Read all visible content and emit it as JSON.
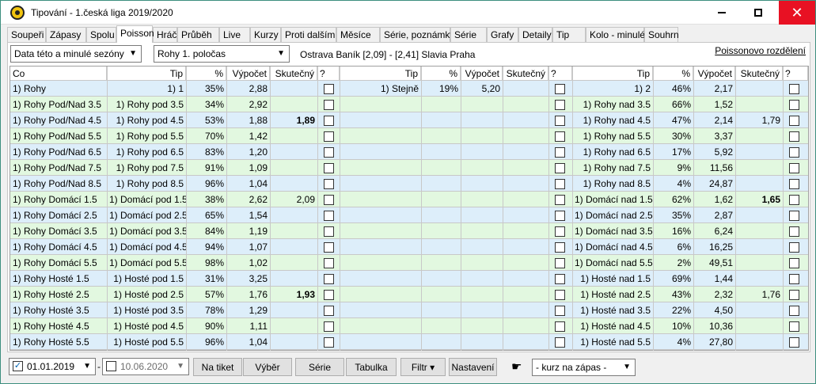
{
  "window": {
    "title": "Tipování - 1.česká liga 2019/2020"
  },
  "tabs": [
    "Soupeři",
    "Zápasy",
    "Spolu",
    "Poisson",
    "Hráči",
    "Průběh",
    "Live",
    "Kurzy",
    "Proti dalším",
    "Měsíce",
    "Série, poznámky",
    "Série",
    "Grafy",
    "Detaily",
    "Tip",
    "Kolo - minulé",
    "Souhrn"
  ],
  "active_tab": "Poisson",
  "filters": {
    "seasons": "Data této a minulé sezóny",
    "market": "Rohy 1. poločas",
    "match": "Ostrava Baník [2,09] - [2,41] Slavia Praha",
    "poisson_link": "Poissonovo rozdělení"
  },
  "columns": {
    "co": "Co",
    "tip": "Tip",
    "pct": "%",
    "calc": "Výpočet",
    "actual": "Skutečný",
    "q": "?"
  },
  "rows": [
    {
      "co": "1) Rohy",
      "t1": "1) 1",
      "p1": "35%",
      "c1": "2,88",
      "a1": "",
      "a1b": false,
      "t2": "1) Stejně",
      "p2": "19%",
      "c2": "5,20",
      "a2": "",
      "a2b": false,
      "t3": "1) 2",
      "p3": "46%",
      "c3": "2,17",
      "a3": "",
      "a3b": false
    },
    {
      "co": "1) Rohy Pod/Nad 3.5",
      "t1": "1) Rohy pod 3.5",
      "p1": "34%",
      "c1": "2,92",
      "a1": "",
      "a1b": false,
      "t2": "",
      "p2": "",
      "c2": "",
      "a2": "",
      "a2b": false,
      "t3": "1) Rohy nad 3.5",
      "p3": "66%",
      "c3": "1,52",
      "a3": "",
      "a3b": false
    },
    {
      "co": "1) Rohy Pod/Nad 4.5",
      "t1": "1) Rohy pod 4.5",
      "p1": "53%",
      "c1": "1,88",
      "a1": "1,89",
      "a1b": true,
      "t2": "",
      "p2": "",
      "c2": "",
      "a2": "",
      "a2b": false,
      "t3": "1) Rohy nad 4.5",
      "p3": "47%",
      "c3": "2,14",
      "a3": "1,79",
      "a3b": false
    },
    {
      "co": "1) Rohy Pod/Nad 5.5",
      "t1": "1) Rohy pod 5.5",
      "p1": "70%",
      "c1": "1,42",
      "a1": "",
      "a1b": false,
      "t2": "",
      "p2": "",
      "c2": "",
      "a2": "",
      "a2b": false,
      "t3": "1) Rohy nad 5.5",
      "p3": "30%",
      "c3": "3,37",
      "a3": "",
      "a3b": false
    },
    {
      "co": "1) Rohy Pod/Nad 6.5",
      "t1": "1) Rohy pod 6.5",
      "p1": "83%",
      "c1": "1,20",
      "a1": "",
      "a1b": false,
      "t2": "",
      "p2": "",
      "c2": "",
      "a2": "",
      "a2b": false,
      "t3": "1) Rohy nad 6.5",
      "p3": "17%",
      "c3": "5,92",
      "a3": "",
      "a3b": false
    },
    {
      "co": "1) Rohy Pod/Nad 7.5",
      "t1": "1) Rohy pod 7.5",
      "p1": "91%",
      "c1": "1,09",
      "a1": "",
      "a1b": false,
      "t2": "",
      "p2": "",
      "c2": "",
      "a2": "",
      "a2b": false,
      "t3": "1) Rohy nad 7.5",
      "p3": "9%",
      "c3": "11,56",
      "a3": "",
      "a3b": false
    },
    {
      "co": "1) Rohy Pod/Nad 8.5",
      "t1": "1) Rohy pod 8.5",
      "p1": "96%",
      "c1": "1,04",
      "a1": "",
      "a1b": false,
      "t2": "",
      "p2": "",
      "c2": "",
      "a2": "",
      "a2b": false,
      "t3": "1) Rohy nad 8.5",
      "p3": "4%",
      "c3": "24,87",
      "a3": "",
      "a3b": false
    },
    {
      "co": "1) Rohy Domácí 1.5",
      "t1": "1) Domácí pod 1.5",
      "p1": "38%",
      "c1": "2,62",
      "a1": "2,09",
      "a1b": false,
      "t2": "",
      "p2": "",
      "c2": "",
      "a2": "",
      "a2b": false,
      "t3": "1) Domácí nad 1.5",
      "p3": "62%",
      "c3": "1,62",
      "a3": "1,65",
      "a3b": true
    },
    {
      "co": "1) Rohy Domácí 2.5",
      "t1": "1) Domácí pod 2.5",
      "p1": "65%",
      "c1": "1,54",
      "a1": "",
      "a1b": false,
      "t2": "",
      "p2": "",
      "c2": "",
      "a2": "",
      "a2b": false,
      "t3": "1) Domácí nad 2.5",
      "p3": "35%",
      "c3": "2,87",
      "a3": "",
      "a3b": false
    },
    {
      "co": "1) Rohy Domácí 3.5",
      "t1": "1) Domácí pod 3.5",
      "p1": "84%",
      "c1": "1,19",
      "a1": "",
      "a1b": false,
      "t2": "",
      "p2": "",
      "c2": "",
      "a2": "",
      "a2b": false,
      "t3": "1) Domácí nad 3.5",
      "p3": "16%",
      "c3": "6,24",
      "a3": "",
      "a3b": false
    },
    {
      "co": "1) Rohy Domácí 4.5",
      "t1": "1) Domácí pod 4.5",
      "p1": "94%",
      "c1": "1,07",
      "a1": "",
      "a1b": false,
      "t2": "",
      "p2": "",
      "c2": "",
      "a2": "",
      "a2b": false,
      "t3": "1) Domácí nad 4.5",
      "p3": "6%",
      "c3": "16,25",
      "a3": "",
      "a3b": false
    },
    {
      "co": "1) Rohy Domácí 5.5",
      "t1": "1) Domácí pod 5.5",
      "p1": "98%",
      "c1": "1,02",
      "a1": "",
      "a1b": false,
      "t2": "",
      "p2": "",
      "c2": "",
      "a2": "",
      "a2b": false,
      "t3": "1) Domácí nad 5.5",
      "p3": "2%",
      "c3": "49,51",
      "a3": "",
      "a3b": false
    },
    {
      "co": "1) Rohy Hosté 1.5",
      "t1": "1) Hosté pod 1.5",
      "p1": "31%",
      "c1": "3,25",
      "a1": "",
      "a1b": false,
      "t2": "",
      "p2": "",
      "c2": "",
      "a2": "",
      "a2b": false,
      "t3": "1) Hosté nad 1.5",
      "p3": "69%",
      "c3": "1,44",
      "a3": "",
      "a3b": false
    },
    {
      "co": "1) Rohy Hosté 2.5",
      "t1": "1) Hosté pod 2.5",
      "p1": "57%",
      "c1": "1,76",
      "a1": "1,93",
      "a1b": true,
      "t2": "",
      "p2": "",
      "c2": "",
      "a2": "",
      "a2b": false,
      "t3": "1) Hosté nad 2.5",
      "p3": "43%",
      "c3": "2,32",
      "a3": "1,76",
      "a3b": false
    },
    {
      "co": "1) Rohy Hosté 3.5",
      "t1": "1) Hosté pod 3.5",
      "p1": "78%",
      "c1": "1,29",
      "a1": "",
      "a1b": false,
      "t2": "",
      "p2": "",
      "c2": "",
      "a2": "",
      "a2b": false,
      "t3": "1) Hosté nad 3.5",
      "p3": "22%",
      "c3": "4,50",
      "a3": "",
      "a3b": false
    },
    {
      "co": "1) Rohy Hosté 4.5",
      "t1": "1) Hosté pod 4.5",
      "p1": "90%",
      "c1": "1,11",
      "a1": "",
      "a1b": false,
      "t2": "",
      "p2": "",
      "c2": "",
      "a2": "",
      "a2b": false,
      "t3": "1) Hosté nad 4.5",
      "p3": "10%",
      "c3": "10,36",
      "a3": "",
      "a3b": false
    },
    {
      "co": "1) Rohy Hosté 5.5",
      "t1": "1) Hosté pod 5.5",
      "p1": "96%",
      "c1": "1,04",
      "a1": "",
      "a1b": false,
      "t2": "",
      "p2": "",
      "c2": "",
      "a2": "",
      "a2b": false,
      "t3": "1) Hosté nad 5.5",
      "p3": "4%",
      "c3": "27,80",
      "a3": "",
      "a3b": false
    }
  ],
  "bottom": {
    "date_from": "01.01.2019",
    "date_from_checked": true,
    "date_sep": "-",
    "date_to": "10.06.2020",
    "date_to_checked": false,
    "buttons": [
      "Na tiket",
      "Výběr",
      "Série",
      "Tabulka",
      "Filtr ▾",
      "Nastavení"
    ],
    "hand_icon": "pointing-hand-icon",
    "kurz_select": "- kurz na zápas -"
  },
  "colors": {
    "row_blue": "#ddeefa",
    "row_green": "#e2f8e0",
    "close_button": "#e81123"
  }
}
